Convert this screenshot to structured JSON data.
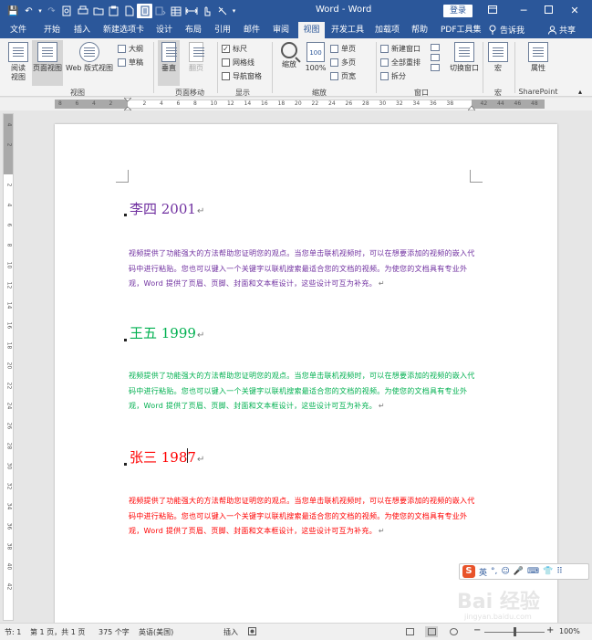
{
  "titlebar": {
    "title": "Word - Word",
    "login": "登录",
    "qat": {
      "save": "💾",
      "undo": "↶",
      "undo_arrow": "▾",
      "redo": "↷"
    }
  },
  "tabs": [
    {
      "id": "file",
      "label": "文件",
      "active": false
    },
    {
      "id": "home",
      "label": "开始",
      "active": false
    },
    {
      "id": "insert",
      "label": "插入",
      "active": false
    },
    {
      "id": "newtab",
      "label": "新建选项卡",
      "active": false
    },
    {
      "id": "design",
      "label": "设计",
      "active": false
    },
    {
      "id": "layout",
      "label": "布局",
      "active": false
    },
    {
      "id": "references",
      "label": "引用",
      "active": false
    },
    {
      "id": "mailings",
      "label": "邮件",
      "active": false
    },
    {
      "id": "review",
      "label": "审阅",
      "active": false
    },
    {
      "id": "view",
      "label": "视图",
      "active": true
    },
    {
      "id": "developer",
      "label": "开发工具",
      "active": false
    },
    {
      "id": "addins",
      "label": "加载项",
      "active": false
    },
    {
      "id": "help",
      "label": "帮助",
      "active": false
    },
    {
      "id": "pdf",
      "label": "PDF工具集",
      "active": false
    }
  ],
  "tell_me": "告诉我",
  "share": "共享",
  "ribbon": {
    "views": {
      "read_mode": "阅读\n视图",
      "print_layout": "页面视图",
      "web_layout": "Web 版式视图",
      "outline": "大纲",
      "draft": "草稿",
      "group": "视图"
    },
    "page_movement": {
      "vertical": "垂直",
      "side_by_side": "翻页",
      "group": "页面移动"
    },
    "show": {
      "ruler": "标尺",
      "ruler_checked": "✓",
      "gridlines": "网格线",
      "nav_pane": "导航窗格",
      "group": "显示"
    },
    "zoom": {
      "zoom": "缩放",
      "hundred": "100%",
      "hundred_icon": "100",
      "one_page": "单页",
      "multi_page": "多页",
      "page_width": "页宽",
      "group": "缩放"
    },
    "window": {
      "new_window": "新建窗口",
      "arrange_all": "全部重排",
      "split": "拆分",
      "switch_windows": "切换窗口",
      "group": "窗口"
    },
    "macros": {
      "label": "宏",
      "group": "宏"
    },
    "sharepoint": {
      "label": "属性",
      "group": "SharePoint"
    }
  },
  "ruler": {
    "h_ticks": [
      "8",
      "6",
      "4",
      "2",
      "",
      "2",
      "4",
      "6",
      "8",
      "10",
      "12",
      "14",
      "16",
      "18",
      "20",
      "22",
      "24",
      "26",
      "28",
      "30",
      "32",
      "34",
      "36",
      "38",
      "",
      "42",
      "44",
      "46",
      "48"
    ],
    "v_ticks": [
      "4",
      "2",
      "",
      "2",
      "4",
      "6",
      "8",
      "10",
      "12",
      "14",
      "16",
      "18",
      "20",
      "22",
      "24",
      "26",
      "28",
      "30",
      "32",
      "34",
      "36",
      "38",
      "40",
      "42"
    ],
    "corner": "L"
  },
  "document": {
    "sections": [
      {
        "heading": "李四 2001",
        "color": "#7030a0",
        "body": "视频提供了功能强大的方法帮助您证明您的观点。当您单击联机视频时，可以在想要添加的视频的嵌入代码中进行粘贴。您也可以键入一个关键字以联机搜索最适合您的文档的视频。为使您的文档具有专业外观，Word 提供了页眉、页脚、封面和文本框设计，这些设计可互为补充。"
      },
      {
        "heading": "王五 1999",
        "color": "#00b050",
        "body": "视频提供了功能强大的方法帮助您证明您的观点。当您单击联机视频时，可以在想要添加的视频的嵌入代码中进行粘贴。您也可以键入一个关键字以联机搜索最适合您的文档的视频。为使您的文档具有专业外观，Word 提供了页眉、页脚、封面和文本框设计，这些设计可互为补充。"
      },
      {
        "heading": "张三 1987",
        "color": "#ff0000",
        "body": "视频提供了功能强大的方法帮助您证明您的观点。当您单击联机视频时，可以在想要添加的视频的嵌入代码中进行粘贴。您也可以键入一个关键字以联机搜索最适合您的文档的视频。为使您的文档具有专业外观，Word 提供了页眉、页脚、封面和文本框设计，这些设计可互为补充。"
      }
    ],
    "para_mark": "↵"
  },
  "ime": {
    "logo": "S",
    "lang": "英",
    "items": [
      "°,",
      "☺",
      "🎤",
      "⌨",
      "👕",
      "⠿"
    ]
  },
  "watermark": {
    "main": "Bai 经验",
    "sub": "jingyan.baidu.com"
  },
  "statusbar": {
    "section": "节: 1",
    "page": "第 1 页，共 1 页",
    "words": "375 个字",
    "language": "英语(美国)",
    "insert_mode": "插入",
    "zoom_minus": "−",
    "zoom_plus": "+",
    "zoom_level": "100%"
  }
}
